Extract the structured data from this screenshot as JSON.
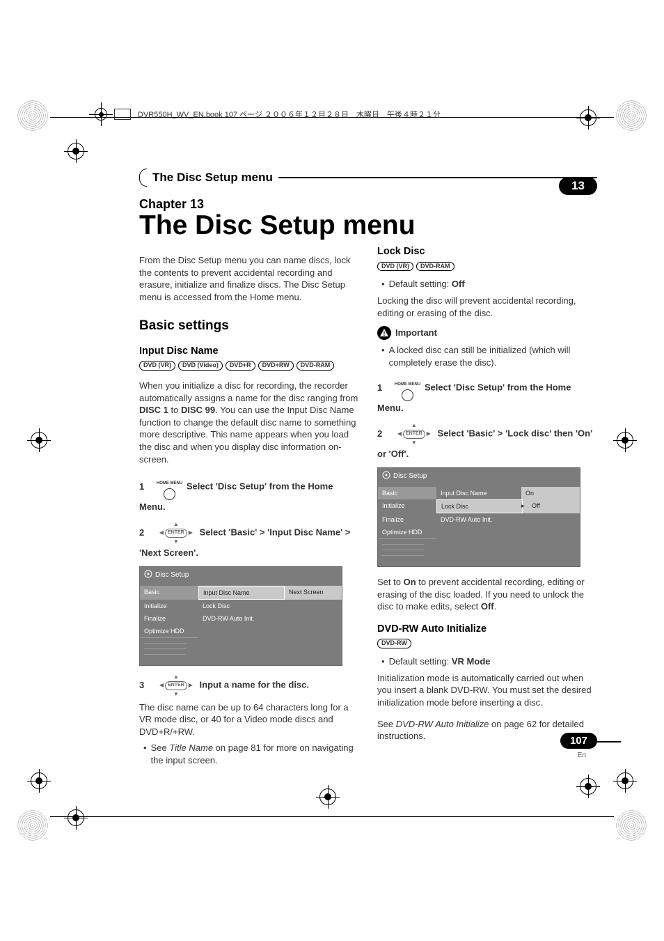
{
  "header_line": "DVR550H_WV_EN.book  107 ページ  ２００６年１２月２８日　木曜日　午後４時２１分",
  "title_bar": "The Disc Setup menu",
  "chapter_num": "13",
  "chapter_label": "Chapter 13",
  "main_title": "The Disc Setup menu",
  "intro": "From the Disc Setup menu you can name discs, lock the contents to prevent accidental recording and erasure, initialize and finalize discs. The Disc Setup menu is accessed from the Home menu.",
  "basic_heading": "Basic settings",
  "input_disc_name": {
    "h": "Input Disc Name",
    "badges": [
      "DVD (VR)",
      "DVD (Video)",
      "DVD+R",
      "DVD+RW",
      "DVD-RAM"
    ],
    "para": "When you initialize a disc for recording, the recorder automatically assigns a name for the disc ranging from ",
    "disc1": "DISC 1",
    "to": " to ",
    "disc99": "DISC 99",
    "para_tail": ". You can use the Input Disc Name function to change the default disc name to something more descriptive. This name appears when you load the disc and when you display disc information on-screen.",
    "step1_pre": "1",
    "step1_icon_label": "HOME MENU",
    "step1": "Select 'Disc Setup' from the Home Menu.",
    "step2_pre": "2",
    "step2_icon_label": "ENTER",
    "step2": "Select 'Basic' > 'Input Disc Name' > 'Next Screen'.",
    "step3_pre": "3",
    "step3": "Input a name for the disc.",
    "step3_para": "The disc name can be up to 64 characters long for a VR mode disc, or 40 for a Video mode discs and DVD+R/+RW.",
    "note_pre": "See ",
    "note_i": "Title Name",
    "note_tail": " on page 81 for more on navigating the input screen."
  },
  "osd1": {
    "title": "Disc Setup",
    "col1": [
      "Basic",
      "Initialize",
      "Finalize",
      "Optimize HDD"
    ],
    "col2": [
      "Input Disc Name",
      "Lock Disc",
      "DVD-RW Auto Init."
    ],
    "col3": [
      "Next Screen"
    ]
  },
  "lock_disc": {
    "h": "Lock Disc",
    "badges": [
      "DVD (VR)",
      "DVD-RAM"
    ],
    "default_label": "Default setting: ",
    "default_val": "Off",
    "para": "Locking the disc will prevent accidental recording, editing or erasing of the disc.",
    "important": "Important",
    "imp_bullet": "A locked disc can still be initialized (which will completely erase the disc).",
    "step1_pre": "1",
    "step1_icon_label": "HOME MENU",
    "step1": "Select 'Disc Setup' from the Home Menu.",
    "step2_pre": "2",
    "step2_icon_label": "ENTER",
    "step2": "Select 'Basic' > 'Lock disc' then 'On' or 'Off'.",
    "after_pre": "Set to ",
    "after_on": "On",
    "after_mid": " to prevent accidental recording, editing or erasing of the disc loaded. If you need to unlock the disc to make edits, select ",
    "after_off": "Off",
    "after_tail": "."
  },
  "osd2": {
    "title": "Disc Setup",
    "col1": [
      "Basic",
      "Initialize",
      "Finalize",
      "Optimize HDD"
    ],
    "col2": [
      "Input Disc Name",
      "Lock Disc",
      "DVD-RW Auto Init."
    ],
    "col3": [
      "On",
      "Off"
    ]
  },
  "auto_init": {
    "h": "DVD-RW Auto Initialize",
    "badges": [
      "DVD-RW"
    ],
    "default_label": "Default setting: ",
    "default_val": "VR Mode",
    "para": "Initialization mode is automatically carried out when you insert a blank DVD-RW. You must set the desired initialization mode before inserting a disc.",
    "see_pre": "See ",
    "see_i": "DVD-RW Auto Initialize",
    "see_tail": " on page 62 for detailed instructions."
  },
  "page_num": "107",
  "page_lang": "En"
}
